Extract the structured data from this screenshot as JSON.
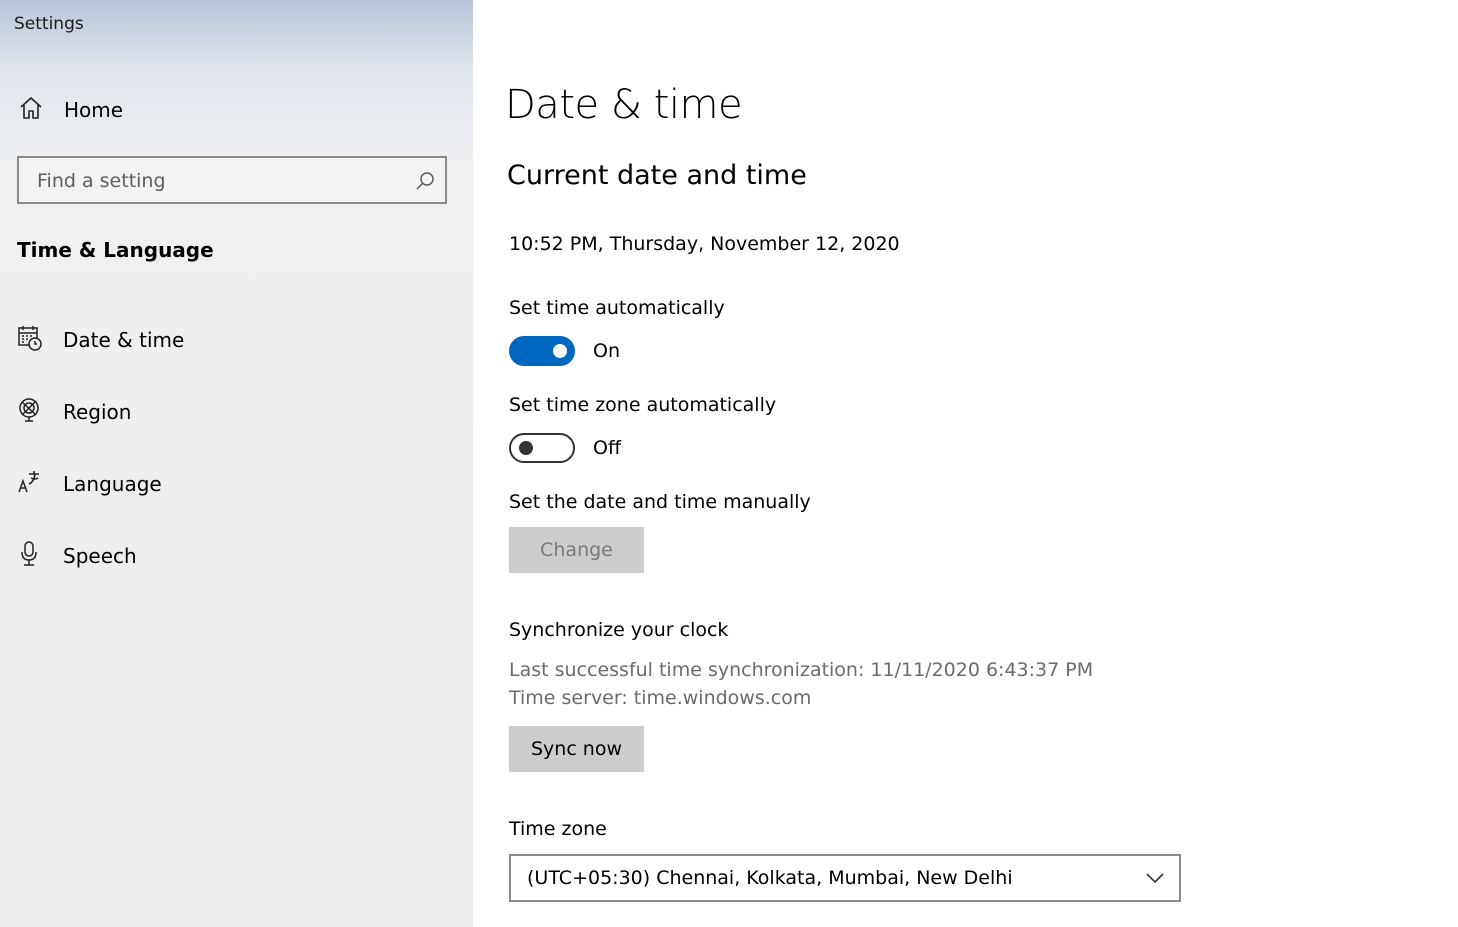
{
  "app": {
    "title": "Settings"
  },
  "sidebar": {
    "home": {
      "icon": "home-icon",
      "label": "Home"
    },
    "search": {
      "placeholder": "Find a setting",
      "icon": "search-icon"
    },
    "section_title": "Time & Language",
    "items": [
      {
        "icon": "calendar-clock-icon",
        "label": "Date & time",
        "selected": true
      },
      {
        "icon": "globe-icon",
        "label": "Region"
      },
      {
        "icon": "language-icon",
        "label": "Language"
      },
      {
        "icon": "microphone-icon",
        "label": "Speech"
      }
    ]
  },
  "main": {
    "title": "Date & time",
    "subtitle": "Current date and time",
    "current_datetime": "10:52 PM, Thursday, November 12, 2020",
    "set_time_auto": {
      "label": "Set time automatically",
      "state": "On",
      "on": true
    },
    "set_timezone_auto": {
      "label": "Set time zone automatically",
      "state": "Off",
      "on": false
    },
    "manual": {
      "label": "Set the date and time manually",
      "button": "Change",
      "disabled": true
    },
    "sync": {
      "label": "Synchronize your clock",
      "last_sync": "Last successful time synchronization: 11/11/2020 6:43:37 PM",
      "server": "Time server: time.windows.com",
      "button": "Sync now"
    },
    "timezone": {
      "label": "Time zone",
      "value": "(UTC+05:30) Chennai, Kolkata, Mumbai, New Delhi",
      "icon": "chevron-down-icon"
    },
    "colors": {
      "accent": "#0067c0",
      "button_bg": "#cccccc"
    }
  }
}
